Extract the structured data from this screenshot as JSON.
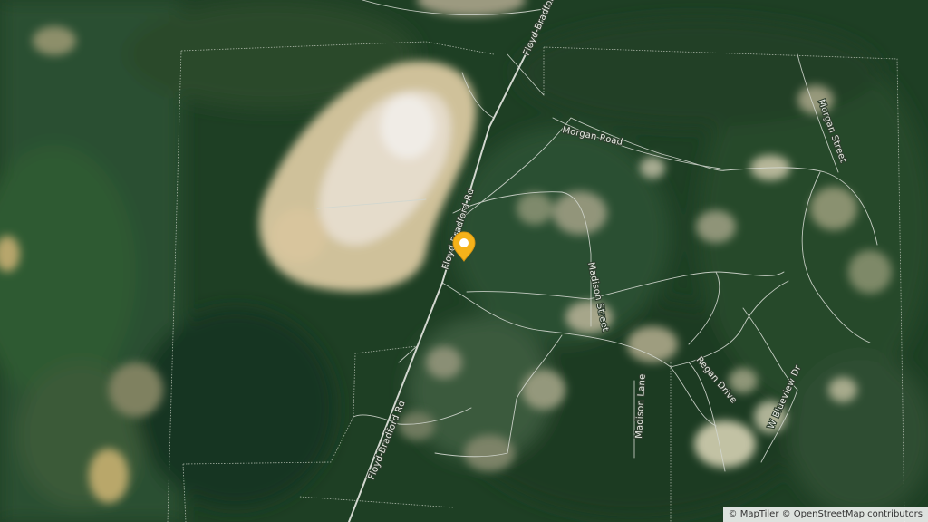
{
  "map": {
    "roads": {
      "floyd_north": "Floyd-Bradford",
      "floyd_mid": "Floyd-Bradford Rd",
      "floyd_south": "Floyd-Bradford Rd",
      "morgan_road": "Morgan Road",
      "morgan_street": "Morgan Street",
      "madison_street": "Madison Street",
      "madison_lane": "Madison Lane",
      "regan_drive": "Regan Drive",
      "blueview": "W Blueview Dr"
    },
    "marker_color": "#f5b21a",
    "marker_icon": "map-pin-icon"
  },
  "attribution": {
    "maptiler": "© MapTiler",
    "osm": "© OpenStreetMap contributors"
  }
}
